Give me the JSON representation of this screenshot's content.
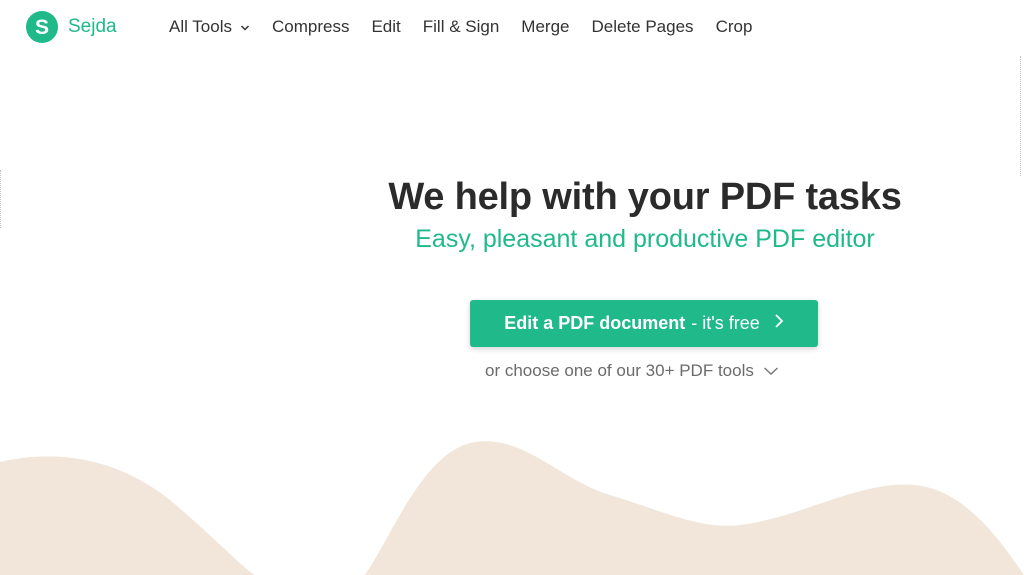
{
  "brand": {
    "name": "Sejda",
    "logo_letter": "S",
    "color": "#1fb98a"
  },
  "nav": {
    "items": [
      {
        "label": "All Tools",
        "has_dropdown": true,
        "icon": "chevron-down-icon"
      },
      {
        "label": "Compress"
      },
      {
        "label": "Edit"
      },
      {
        "label": "Fill & Sign"
      },
      {
        "label": "Merge"
      },
      {
        "label": "Delete Pages"
      },
      {
        "label": "Crop"
      }
    ]
  },
  "hero": {
    "title": "We help with your PDF tasks",
    "subtitle": "Easy, pleasant and productive PDF editor",
    "cta": {
      "strong_label": "Edit a PDF document",
      "light_label": "- it's free",
      "icon": "chevron-right-icon"
    },
    "choose_text": "or choose one of our 30+ PDF tools",
    "choose_icon": "chevron-down-icon"
  },
  "colors": {
    "accent": "#1fb98a",
    "title": "#2b2b2b",
    "muted": "#6b6b6b",
    "wave": "#f2e6da"
  }
}
